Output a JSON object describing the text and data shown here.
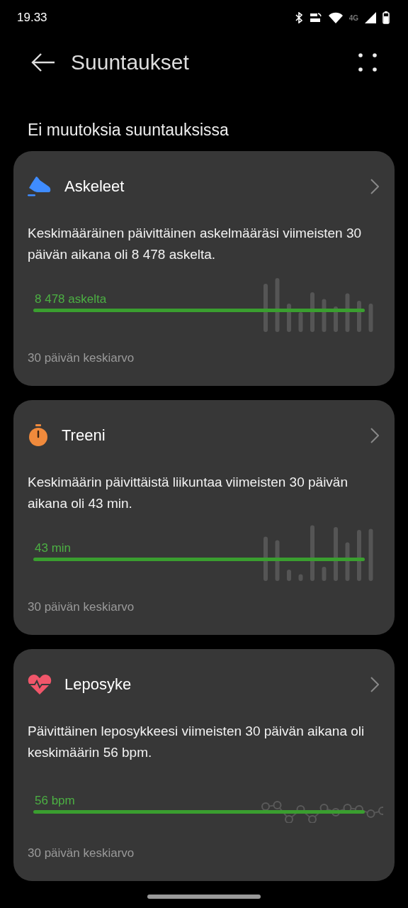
{
  "status_bar": {
    "time": "19.33",
    "network": "4G"
  },
  "header": {
    "title": "Suuntaukset"
  },
  "section_title": "Ei muutoksia suuntauksissa",
  "cards": [
    {
      "kind": "steps",
      "title": "Askeleet",
      "description": "Keskimääräinen päivittäinen askelmääräsi viimeisten 30 päivän aikana oli 8 478 askelta.",
      "average_label": "8 478 askelta",
      "caption": "30 päivän keskiarvo"
    },
    {
      "kind": "workout",
      "title": "Treeni",
      "description": "Keskimäärin päivittäistä liikuntaa viimeisten 30 päivän aikana oli 43 min.",
      "average_label": "43 min",
      "caption": "30 päivän keskiarvo"
    },
    {
      "kind": "heart",
      "title": "Leposyke",
      "description": "Päivittäinen leposykkeesi viimeisten 30 päivän aikana oli keskimäärin 56 bpm.",
      "average_label": "56 bpm",
      "caption": "30 päivän keskiarvo"
    }
  ]
}
